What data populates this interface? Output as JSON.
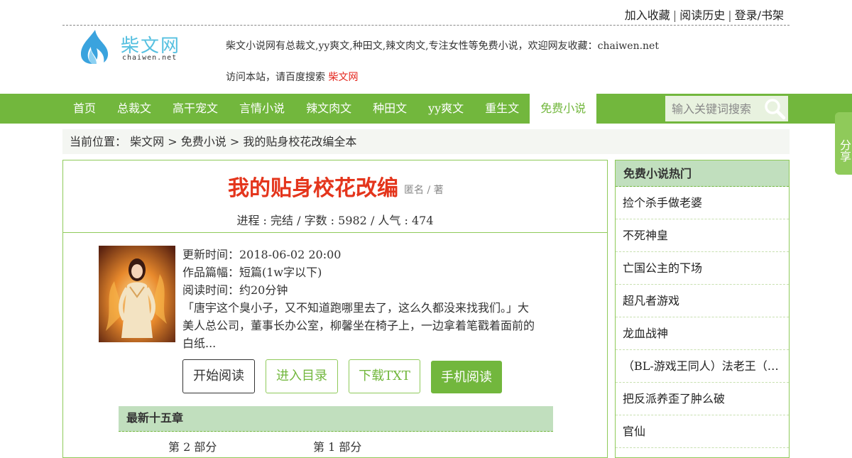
{
  "toplinks": {
    "bookmark": "加入收藏",
    "history": "阅读历史",
    "login": "登录/书架",
    "sep": "|"
  },
  "logo": {
    "name": "柴文网",
    "sub": "chaiwen.net"
  },
  "slogan": "柴文小说网有总裁文,yy爽文,种田文,辣文肉文,专注女性等免费小说，欢迎网友收藏：chaiwen.net",
  "visit": {
    "text": "访问本站，请百度搜索",
    "keyword": "柴文网"
  },
  "nav": {
    "items": [
      {
        "label": "首页"
      },
      {
        "label": "总裁文"
      },
      {
        "label": "高干宠文"
      },
      {
        "label": "言情小说"
      },
      {
        "label": "辣文肉文"
      },
      {
        "label": "种田文"
      },
      {
        "label": "yy爽文"
      },
      {
        "label": "重生文"
      },
      {
        "label": "免费小说"
      }
    ],
    "active_index": 8
  },
  "search": {
    "placeholder": "输入关键词搜索"
  },
  "share": {
    "label": "分享"
  },
  "breadcrumb": {
    "prefix": "当前位置：",
    "home": "柴文网",
    "category": "免费小说",
    "current": "我的贴身校花改编全本",
    "sep": ">"
  },
  "book": {
    "title": "我的贴身校花改编",
    "author": "匿名 / 著",
    "progress": "进程 : 完结 / 字数 : 5982 / 人气 : 474",
    "updated": "更新时间：2018-06-02 20:00",
    "length": "作品篇幅：短篇(1w字以下)",
    "read_time": "阅读时间：约20分钟",
    "description": "「唐宇这个臭小子，又不知道跑哪里去了，这么久都没来找我们。」大美人总公司，董事长办公室，柳馨坐在椅子上，一边拿着笔戳着面前的白纸..."
  },
  "buttons": {
    "start": "开始阅读",
    "catalog": "进入目录",
    "download": "下载TXT",
    "mobile": "手机阅读"
  },
  "latest": {
    "heading": "最新十五章",
    "chapters": [
      {
        "label": "第 2 部分"
      },
      {
        "label": "第 1 部分"
      }
    ]
  },
  "sidebar": {
    "heading": "免费小说热门",
    "items": [
      {
        "label": "捡个杀手做老婆"
      },
      {
        "label": "不死神皇"
      },
      {
        "label": "亡国公主的下场"
      },
      {
        "label": "超凡者游戏"
      },
      {
        "label": "龙血战神"
      },
      {
        "label": "（BL-游戏王同人）法老王（…"
      },
      {
        "label": "把反派养歪了肿么破"
      },
      {
        "label": "官仙"
      }
    ]
  },
  "colors": {
    "brand_green": "#72b73d",
    "title_red": "#e4351c",
    "header_green": "#c1dfbe"
  }
}
